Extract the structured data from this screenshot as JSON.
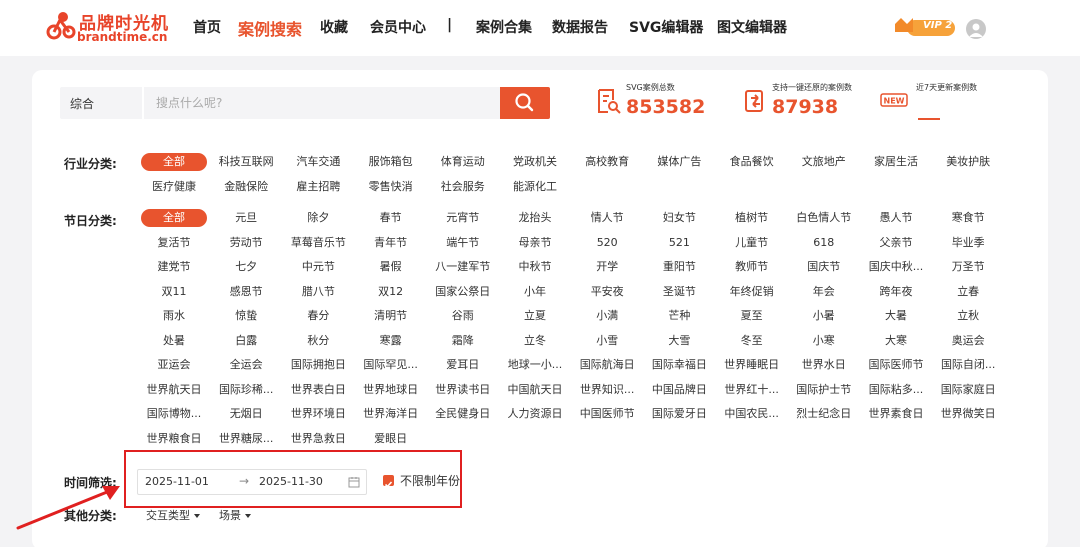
{
  "brand": {
    "name_cn": "品牌时光机",
    "domain": "brandtime.cn"
  },
  "nav": {
    "items": [
      {
        "label": "首页",
        "active": false
      },
      {
        "label": "案例搜索",
        "active": true
      },
      {
        "label": "收藏",
        "active": false
      },
      {
        "label": "会员中心",
        "active": false
      },
      {
        "label": "|",
        "active": false
      },
      {
        "label": "案例合集",
        "active": false
      },
      {
        "label": "数据报告",
        "active": false
      },
      {
        "label": "SVG编辑器",
        "active": false
      },
      {
        "label": "图文编辑器",
        "active": false
      }
    ],
    "vip_label": "VIP 2"
  },
  "search": {
    "type": "综合",
    "placeholder": "搜点什么呢?",
    "button_icon": "search-icon"
  },
  "stats": [
    {
      "label": "SVG案例总数",
      "value": "853582",
      "icon": "document-search-icon"
    },
    {
      "label": "支持一键还原的案例数",
      "value": "87938",
      "icon": "restore-icon"
    },
    {
      "label": "近7天更新案例数",
      "value": "",
      "icon": "new-badge-icon"
    }
  ],
  "filters": {
    "industry_label": "行业分类:",
    "industry_tags": [
      "全部",
      "科技互联网",
      "汽车交通",
      "服饰箱包",
      "体育运动",
      "党政机关",
      "高校教育",
      "媒体广告",
      "食品餐饮",
      "文旅地产",
      "家居生活",
      "美妆护肤",
      "医疗健康",
      "金融保险",
      "雇主招聘",
      "零售快消",
      "社会服务",
      "能源化工"
    ],
    "holiday_label": "节日分类:",
    "holiday_tags": [
      "全部",
      "元旦",
      "除夕",
      "春节",
      "元宵节",
      "龙抬头",
      "情人节",
      "妇女节",
      "植树节",
      "白色情人节",
      "愚人节",
      "寒食节",
      "复活节",
      "劳动节",
      "草莓音乐节",
      "青年节",
      "端午节",
      "母亲节",
      "520",
      "521",
      "儿童节",
      "618",
      "父亲节",
      "毕业季",
      "建党节",
      "七夕",
      "中元节",
      "暑假",
      "八一建军节",
      "中秋节",
      "开学",
      "重阳节",
      "教师节",
      "国庆节",
      "国庆中秋...",
      "万圣节",
      "双11",
      "感恩节",
      "腊八节",
      "双12",
      "国家公祭日",
      "小年",
      "平安夜",
      "圣诞节",
      "年终促销",
      "年会",
      "跨年夜",
      "立春",
      "雨水",
      "惊蛰",
      "春分",
      "清明节",
      "谷雨",
      "立夏",
      "小满",
      "芒种",
      "夏至",
      "小暑",
      "大暑",
      "立秋",
      "处暑",
      "白露",
      "秋分",
      "寒露",
      "霜降",
      "立冬",
      "小雪",
      "大雪",
      "冬至",
      "小寒",
      "大寒",
      "奥运会",
      "亚运会",
      "全运会",
      "国际拥抱日",
      "国际罕见...",
      "爱耳日",
      "地球一小...",
      "国际航海日",
      "国际幸福日",
      "世界睡眠日",
      "世界水日",
      "国际医师节",
      "国际自闭...",
      "世界航天日",
      "国际珍稀...",
      "世界表白日",
      "世界地球日",
      "世界读书日",
      "中国航天日",
      "世界知识...",
      "中国品牌日",
      "世界红十...",
      "国际护士节",
      "国际粘多...",
      "国际家庭日",
      "国际博物...",
      "无烟日",
      "世界环境日",
      "世界海洋日",
      "全民健身日",
      "人力资源日",
      "中国医师节",
      "国际爱牙日",
      "中国农民...",
      "烈士纪念日",
      "世界素食日",
      "世界微笑日",
      "世界粮食日",
      "世界糖尿...",
      "世界急救日",
      "爱眼日"
    ],
    "time_label": "时间筛选:",
    "date_start": "2025-11-01",
    "date_separator": "→",
    "date_end": "2025-11-30",
    "no_year_limit_label": "不限制年份",
    "no_year_limit_checked": true,
    "other_label": "其他分类:",
    "other_dropdowns": [
      "交互类型",
      "场景"
    ]
  },
  "colors": {
    "accent": "#e8542e",
    "highlight_box": "#e02020"
  }
}
